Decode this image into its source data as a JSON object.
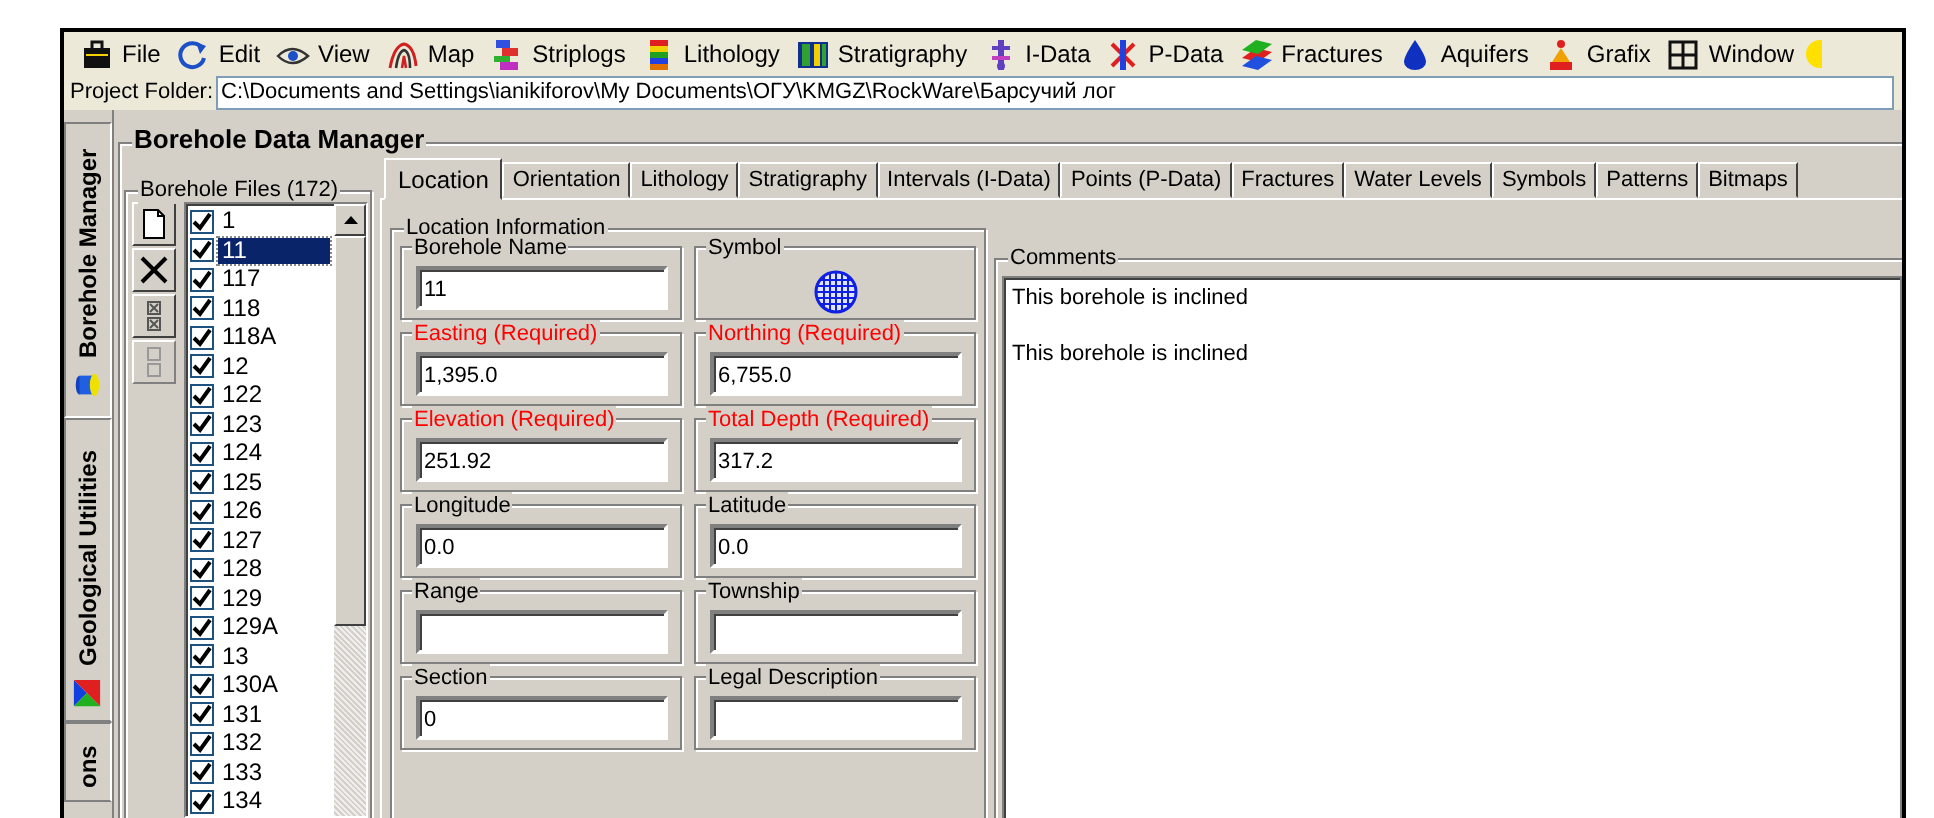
{
  "menu": [
    {
      "label": "File"
    },
    {
      "label": "Edit"
    },
    {
      "label": "View"
    },
    {
      "label": "Map"
    },
    {
      "label": "Striplogs"
    },
    {
      "label": "Lithology"
    },
    {
      "label": "Stratigraphy"
    },
    {
      "label": "I-Data"
    },
    {
      "label": "P-Data"
    },
    {
      "label": "Fractures"
    },
    {
      "label": "Aquifers"
    },
    {
      "label": "Grafix"
    },
    {
      "label": "Window"
    }
  ],
  "project_folder": {
    "label": "Project Folder:",
    "value": "C:\\Documents and Settings\\ianikiforov\\My Documents\\ОГУ\\KMGZ\\RockWare\\Барсучий лог"
  },
  "side_tabs": [
    {
      "label": "Borehole Manager",
      "selected": true
    },
    {
      "label": "Geological Utilities",
      "selected": false
    },
    {
      "label": "ons",
      "selected": false
    }
  ],
  "manager_title": "Borehole Data Manager",
  "files_title": "Borehole Files (172)",
  "files": [
    {
      "label": "1",
      "checked": true,
      "selected": false
    },
    {
      "label": "11",
      "checked": true,
      "selected": true
    },
    {
      "label": "117",
      "checked": true,
      "selected": false
    },
    {
      "label": "118",
      "checked": true,
      "selected": false
    },
    {
      "label": "118A",
      "checked": true,
      "selected": false
    },
    {
      "label": "12",
      "checked": true,
      "selected": false
    },
    {
      "label": "122",
      "checked": true,
      "selected": false
    },
    {
      "label": "123",
      "checked": true,
      "selected": false
    },
    {
      "label": "124",
      "checked": true,
      "selected": false
    },
    {
      "label": "125",
      "checked": true,
      "selected": false
    },
    {
      "label": "126",
      "checked": true,
      "selected": false
    },
    {
      "label": "127",
      "checked": true,
      "selected": false
    },
    {
      "label": "128",
      "checked": true,
      "selected": false
    },
    {
      "label": "129",
      "checked": true,
      "selected": false
    },
    {
      "label": "129A",
      "checked": true,
      "selected": false
    },
    {
      "label": "13",
      "checked": true,
      "selected": false
    },
    {
      "label": "130A",
      "checked": true,
      "selected": false
    },
    {
      "label": "131",
      "checked": true,
      "selected": false
    },
    {
      "label": "132",
      "checked": true,
      "selected": false
    },
    {
      "label": "133",
      "checked": true,
      "selected": false
    },
    {
      "label": "134",
      "checked": true,
      "selected": false
    }
  ],
  "tabs": [
    {
      "label": "Location",
      "selected": true
    },
    {
      "label": "Orientation",
      "selected": false
    },
    {
      "label": "Lithology",
      "selected": false
    },
    {
      "label": "Stratigraphy",
      "selected": false
    },
    {
      "label": "Intervals (I-Data)",
      "selected": false
    },
    {
      "label": "Points (P-Data)",
      "selected": false
    },
    {
      "label": "Fractures",
      "selected": false
    },
    {
      "label": "Water Levels",
      "selected": false
    },
    {
      "label": "Symbols",
      "selected": false
    },
    {
      "label": "Patterns",
      "selected": false
    },
    {
      "label": "Bitmaps",
      "selected": false
    }
  ],
  "location": {
    "title": "Location Information",
    "fields": [
      {
        "kind": "field",
        "label": "Borehole Name",
        "value": "11",
        "required": false
      },
      {
        "kind": "symbol",
        "label": "Symbol"
      },
      {
        "kind": "field",
        "label": "Easting (Required)",
        "value": "1,395.0",
        "required": true
      },
      {
        "kind": "field",
        "label": "Northing (Required)",
        "value": "6,755.0",
        "required": true
      },
      {
        "kind": "field",
        "label": "Elevation (Required)",
        "value": "251.92",
        "required": true
      },
      {
        "kind": "field",
        "label": "Total Depth (Required)",
        "value": "317.2",
        "required": true
      },
      {
        "kind": "field",
        "label": "Longitude",
        "value": "0.0",
        "required": false
      },
      {
        "kind": "field",
        "label": "Latitude",
        "value": "0.0",
        "required": false
      },
      {
        "kind": "field",
        "label": "Range",
        "required": false
      },
      {
        "kind": "field",
        "label": "Township",
        "required": false
      },
      {
        "kind": "field",
        "label": "Section",
        "value": "0",
        "required": false
      },
      {
        "kind": "field",
        "label": "Legal Description",
        "required": false
      }
    ]
  },
  "comments": {
    "label": "Comments",
    "lines": [
      "This borehole is inclined",
      "This borehole is inclined"
    ]
  }
}
